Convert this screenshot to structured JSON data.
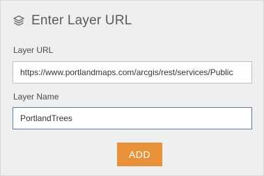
{
  "header": {
    "title": "Enter Layer URL",
    "icon": "layers-icon"
  },
  "url_field": {
    "label": "Layer URL",
    "value": "https://www.portlandmaps.com/arcgis/rest/services/Public"
  },
  "name_field": {
    "label": "Layer Name",
    "value": "PortlandTrees"
  },
  "add_button": {
    "label": "ADD",
    "color": "#e7913a"
  },
  "colors": {
    "background": "#efefef",
    "text": "#4a4a4a",
    "focus_border": "#5c7a9c"
  }
}
